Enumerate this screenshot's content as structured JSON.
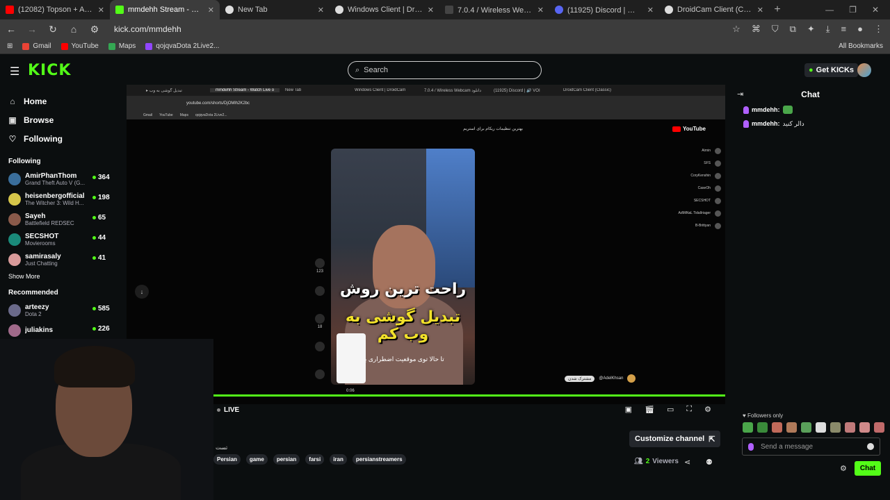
{
  "browser": {
    "tabs": [
      {
        "title": "(12082) Topson + Arteezy + Mi",
        "color": "#ff0000",
        "active": false
      },
      {
        "title": "mmdehh Stream - Watch Live o",
        "color": "#53fc18",
        "active": true
      },
      {
        "title": "New Tab",
        "color": "#dddddd",
        "active": false
      },
      {
        "title": "Windows Client | DroidCam",
        "color": "#dddddd",
        "active": false
      },
      {
        "title": "7.0.4 / Wireless Webcam دانلود",
        "color": "#444444",
        "active": false
      },
      {
        "title": "(11925) Discord | 🔊 VOI",
        "color": "#5865f2",
        "active": false
      },
      {
        "title": "DroidCam Client (Classic)",
        "color": "#dddddd",
        "active": false
      }
    ],
    "url": "kick.com/mmdehh",
    "bookmarks": [
      "Gmail",
      "YouTube",
      "Maps",
      "qojqvaDota 2Live2..."
    ],
    "all_bookmarks": "All Bookmarks"
  },
  "kick": {
    "logo": "KICK",
    "search_placeholder": "Search",
    "get_kicks": "Get KICKs",
    "nav": [
      "Home",
      "Browse",
      "Following"
    ],
    "following_heading": "Following",
    "following": [
      {
        "name": "AmirPhanThom",
        "game": "Grand Theft Auto V (G...",
        "viewers": "364",
        "color": "#3a6e9b"
      },
      {
        "name": "heisenbergofficial",
        "game": "The Witcher 3: Wild H...",
        "viewers": "198",
        "color": "#d6c64a"
      },
      {
        "name": "Sayeh",
        "game": "Battlefield REDSEC",
        "viewers": "65",
        "color": "#8a5a4a"
      },
      {
        "name": "SECSHOT",
        "game": "Movierooms",
        "viewers": "44",
        "color": "#1a8a7a"
      },
      {
        "name": "samirasaly",
        "game": "Just Chatting",
        "viewers": "41",
        "color": "#d89a9a"
      }
    ],
    "show_more": "Show More",
    "recommended_heading": "Recommended",
    "recommended": [
      {
        "name": "arteezy",
        "game": "Dota 2",
        "viewers": "585",
        "color": "#6a6a8a"
      },
      {
        "name": "juliakins",
        "game": "",
        "viewers": "226",
        "color": "#a06a8a"
      }
    ]
  },
  "video": {
    "inner_url": "youtube.com/shorts/DjOMlh2K2bc",
    "yt_search": "بهترین تنظیمات ریکام برای استریم",
    "caption_line1": "راحت ترین روش",
    "caption_line2": "تبدیل گوشی به وب کم",
    "subtitle": "تا حالا توی موقعیت اضطراری بو",
    "time": "0:06",
    "author": "@AdelKhsan",
    "like_count": "123",
    "comment_count": "18",
    "live_label": "LIVE"
  },
  "stream": {
    "title": "تست",
    "tags": [
      "Persian",
      "game",
      "persian",
      "farsi",
      "iran",
      "persianstreamers"
    ],
    "customize": "Customize channel",
    "viewers_count": "2",
    "viewers_label": "Viewers"
  },
  "chat": {
    "title": "Chat",
    "messages": [
      {
        "user": "mmdehh:",
        "text": ""
      },
      {
        "user": "mmdehh:",
        "text": "دالر کنید"
      }
    ],
    "followers_only": "Followers only",
    "placeholder": "Send a message",
    "send": "Chat"
  }
}
